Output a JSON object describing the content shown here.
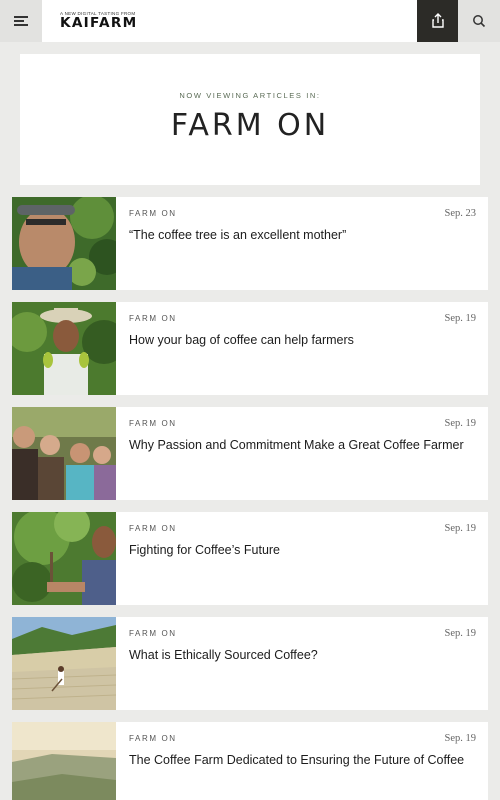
{
  "header": {
    "menu_icon": "hamburger-menu-icon",
    "logo_tagline": "A NEW DIGITAL TASTING FROM",
    "logo_word": "KAIFARM",
    "share_icon": "share-icon",
    "search_icon": "search-icon",
    "colors": {
      "share_bg": "#2c2b27",
      "button_bg": "#e2e2e0"
    }
  },
  "hero": {
    "kicker": "NOW VIEWING ARTICLES IN:",
    "title": "FARM ON"
  },
  "articles": [
    {
      "category": "FARM ON",
      "date": "Sep. 23",
      "title": "“The coffee tree is an excellent mother”"
    },
    {
      "category": "FARM ON",
      "date": "Sep. 19",
      "title": "How your bag of coffee can help farmers"
    },
    {
      "category": "FARM ON",
      "date": "Sep. 19",
      "title": "Why Passion and Commitment Make a Great Coffee Farmer"
    },
    {
      "category": "FARM ON",
      "date": "Sep. 19",
      "title": "Fighting for Coffee’s Future"
    },
    {
      "category": "FARM ON",
      "date": "Sep. 19",
      "title": "What is Ethically Sourced Coffee?"
    },
    {
      "category": "FARM ON",
      "date": "Sep. 19",
      "title": "The Coffee Farm Dedicated to Ensuring the Future of Coffee"
    }
  ]
}
